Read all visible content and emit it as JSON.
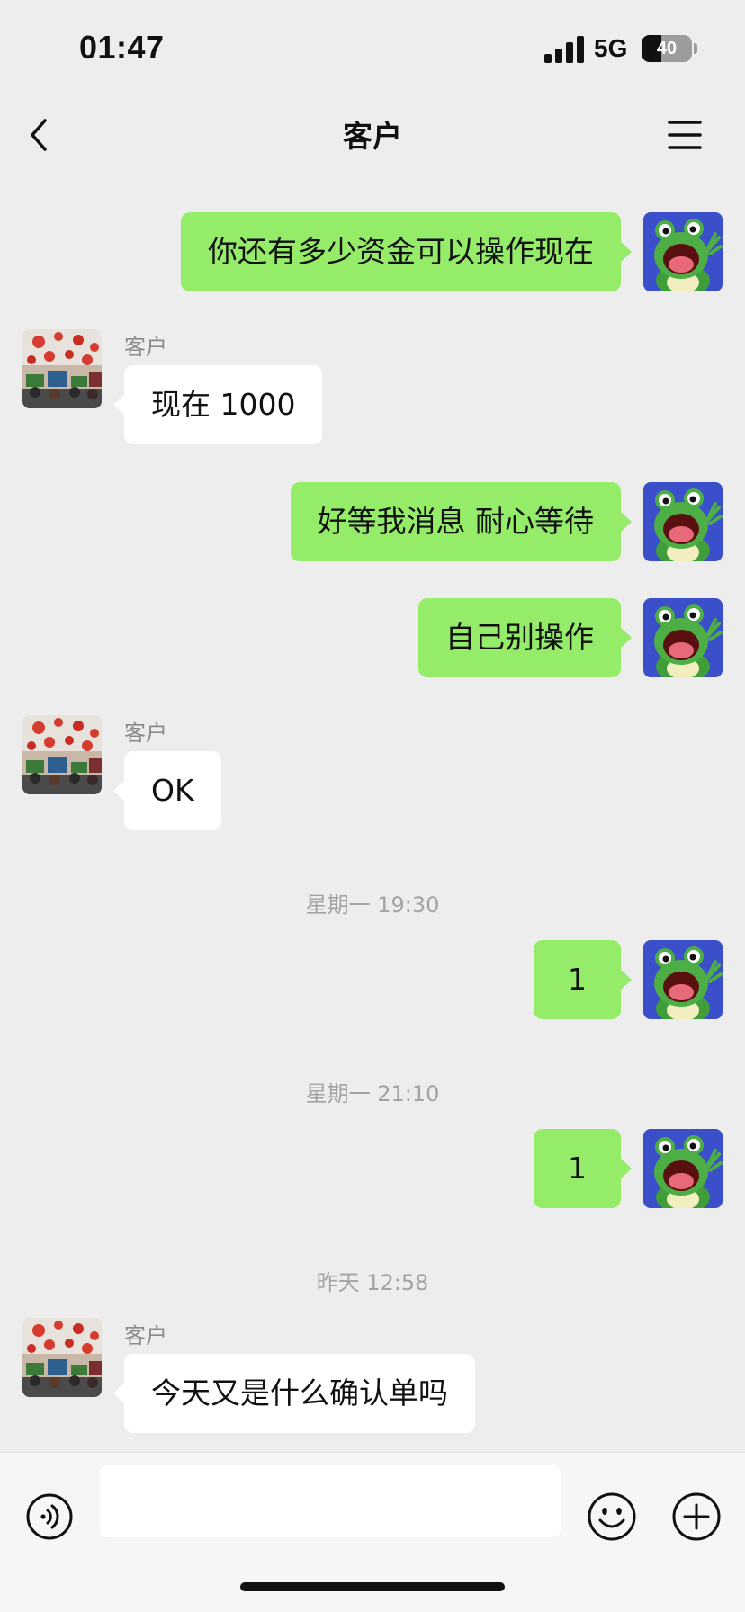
{
  "status_bar": {
    "time": "01:47",
    "network": "5G",
    "battery": "40",
    "battery_level": 0.4
  },
  "nav": {
    "title": "客户",
    "back_icon": "chevron-left-icon",
    "menu_icon": "hamburger-menu-icon"
  },
  "messages": [
    {
      "direction": "outgoing",
      "text": "你还有多少资金可以操作现在"
    },
    {
      "direction": "incoming",
      "sender": "客户",
      "text": "现在 1000"
    },
    {
      "direction": "outgoing",
      "text": "好等我消息 耐心等待"
    },
    {
      "direction": "outgoing",
      "text": "自己别操作"
    },
    {
      "direction": "incoming",
      "sender": "客户",
      "text": "OK"
    },
    {
      "type": "timestamp",
      "text": "星期一 19:30"
    },
    {
      "direction": "outgoing",
      "text": "1"
    },
    {
      "type": "timestamp",
      "text": "星期一 21:10"
    },
    {
      "direction": "outgoing",
      "text": "1"
    },
    {
      "type": "timestamp",
      "text": "昨天 12:58"
    },
    {
      "direction": "incoming",
      "sender": "客户",
      "text": "今天又是什么确认单吗"
    }
  ],
  "input_bar": {
    "voice_icon": "voice-icon",
    "input_value": "",
    "emoji_icon": "emoji-icon",
    "plus_icon": "plus-icon"
  },
  "colors": {
    "outgoing_bubble": "#95ec69",
    "incoming_bubble": "#ffffff",
    "background": "#ededed"
  }
}
